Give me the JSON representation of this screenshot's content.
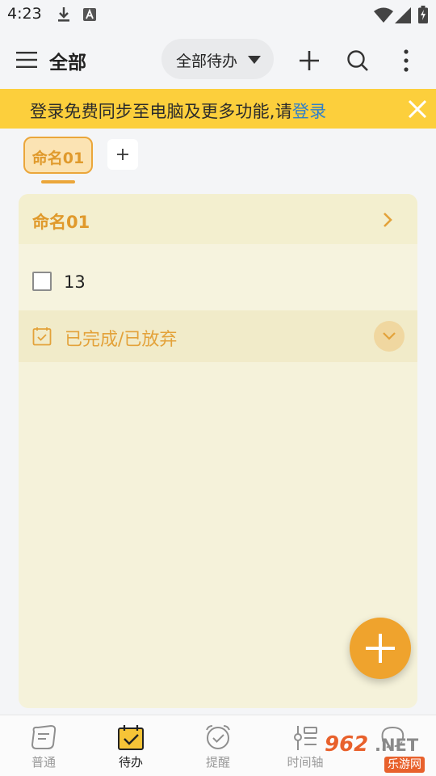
{
  "status_bar": {
    "time": "4:23",
    "icons": [
      "download-icon",
      "font-icon",
      "wifi-icon",
      "signal-icon",
      "battery-icon"
    ]
  },
  "app_bar": {
    "title": "全部",
    "filter": {
      "label": "全部待办"
    },
    "actions": [
      "add-icon",
      "search-icon",
      "more-vertical-icon"
    ]
  },
  "banner": {
    "text": "登录免费同步至电脑及更多功能,请",
    "link": "登录",
    "background": "#fccf3c"
  },
  "tabs": {
    "items": [
      {
        "label": "命名01",
        "selected": true
      }
    ],
    "add_label": "+"
  },
  "list_card": {
    "title": "命名01",
    "items": [
      {
        "text": "13",
        "checked": false
      }
    ],
    "completed_label": "已完成/已放弃"
  },
  "fab": {
    "icon": "add-icon"
  },
  "bottom_nav": {
    "items": [
      {
        "label": "普通",
        "icon": "note-icon",
        "active": false
      },
      {
        "label": "待办",
        "icon": "calendar-check-icon",
        "active": true
      },
      {
        "label": "提醒",
        "icon": "alarm-clock-icon",
        "active": false
      },
      {
        "label": "时间轴",
        "icon": "timeline-icon",
        "active": false
      },
      {
        "label": "",
        "icon": "chat-icon",
        "active": false
      }
    ]
  },
  "watermark": {
    "number": "962",
    "domain": ".NET",
    "site": "乐游网"
  },
  "colors": {
    "accent": "#efa32d",
    "accent_text": "#e09a2c",
    "card": "#f5f2da",
    "link": "#2f7fc9"
  }
}
